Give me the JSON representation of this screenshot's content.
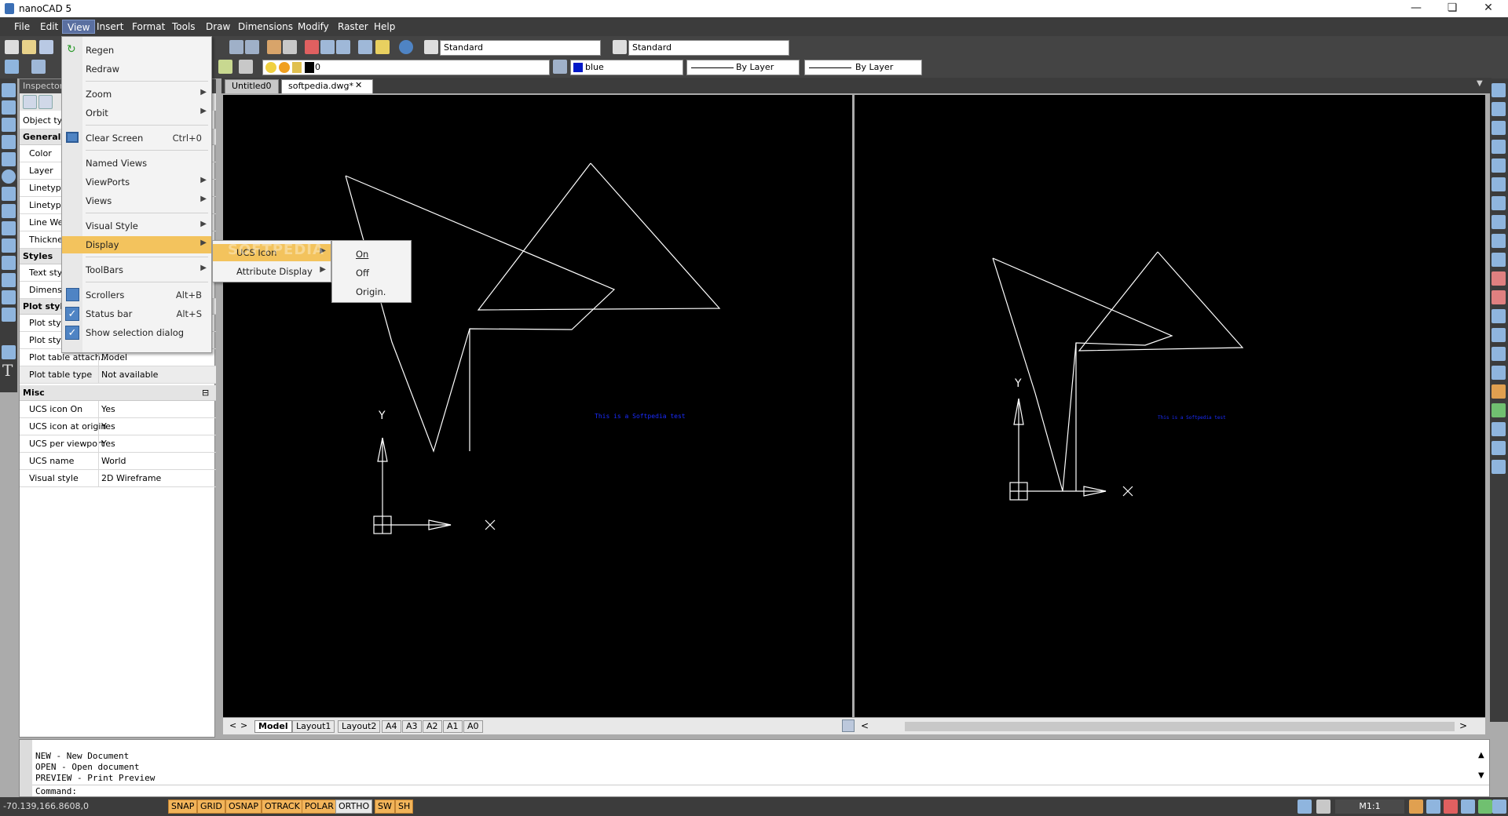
{
  "window": {
    "title": "nanoCAD 5"
  },
  "menubar": [
    "File",
    "Edit",
    "View",
    "Insert",
    "Format",
    "Tools",
    "Draw",
    "Dimensions",
    "Modify",
    "Raster",
    "Help"
  ],
  "toolbar": {
    "textstyle": "Standard",
    "dimstyle": "Standard",
    "layer": "0",
    "color": "blue",
    "linetype": "By Layer",
    "lineweight": "By Layer"
  },
  "view_menu": {
    "regen": "Regen",
    "redraw": "Redraw",
    "zoom": "Zoom",
    "orbit": "Orbit",
    "clear_screen": "Clear Screen",
    "clear_screen_sc": "Ctrl+0",
    "named_views": "Named Views",
    "viewports": "ViewPorts",
    "views": "Views",
    "visual_style": "Visual Style",
    "display": "Display",
    "toolbars": "ToolBars",
    "scrollers": "Scrollers",
    "scrollers_sc": "Alt+B",
    "status_bar": "Status bar",
    "status_bar_sc": "Alt+S",
    "show_selection": "Show selection dialog"
  },
  "display_submenu": {
    "ucs_icon": "UCS Icon",
    "attribute_display": "Attribute Display"
  },
  "ucs_submenu": {
    "on": "On",
    "off": "Off",
    "origin": "Origin."
  },
  "inspector": {
    "title": "Inspector",
    "object_type": "Object typ",
    "general": "General",
    "general_rows": [
      "Color",
      "Layer",
      "Linetype",
      "Linetype",
      "Line We",
      "Thickne"
    ],
    "styles": "Styles",
    "style_rows": [
      "Text styl",
      "Dimensi"
    ],
    "plot_style": "Plot style",
    "plot_rows": [
      "Plot style",
      "Plot style"
    ],
    "plot_table_attach": "Plot table attach...",
    "plot_table_attach_val": "Model",
    "plot_table_type": "Plot table type",
    "plot_table_type_val": "Not available",
    "misc": "Misc",
    "misc_rows": [
      {
        "k": "UCS icon On",
        "v": "Yes"
      },
      {
        "k": "UCS icon at origin",
        "v": "Yes"
      },
      {
        "k": "UCS per viewport",
        "v": "Yes"
      },
      {
        "k": "UCS name",
        "v": "World"
      },
      {
        "k": "Visual style",
        "v": "2D Wireframe"
      }
    ]
  },
  "doc_tabs": {
    "untitled": "Untitled0",
    "active": "softpedia.dwg*"
  },
  "layout_tabs": [
    "Model",
    "Layout1",
    "Layout2",
    "A4",
    "A3",
    "A2",
    "A1",
    "A0"
  ],
  "viewport_text": {
    "left": "This is a Softpedia test",
    "right": "This is a Softpedia test"
  },
  "axis": {
    "y": "Y",
    "x": "X"
  },
  "watermark": "SOFTPEDIA",
  "command": {
    "lines": [
      "NEW - New Document",
      "OPEN - Open document",
      "PREVIEW - Print Preview"
    ],
    "prompt": "Command:"
  },
  "status": {
    "coords": "-70.139,166.8608,0",
    "buttons": [
      "SNAP",
      "GRID",
      "OSNAP",
      "OTRACK",
      "POLAR",
      "ORTHO",
      "SW",
      "SH"
    ],
    "scale": "M1:1"
  },
  "colors": {
    "menu_highlight": "#f3c35d",
    "status_button": "#f2b45a",
    "text_blue": "#1a2cff"
  }
}
